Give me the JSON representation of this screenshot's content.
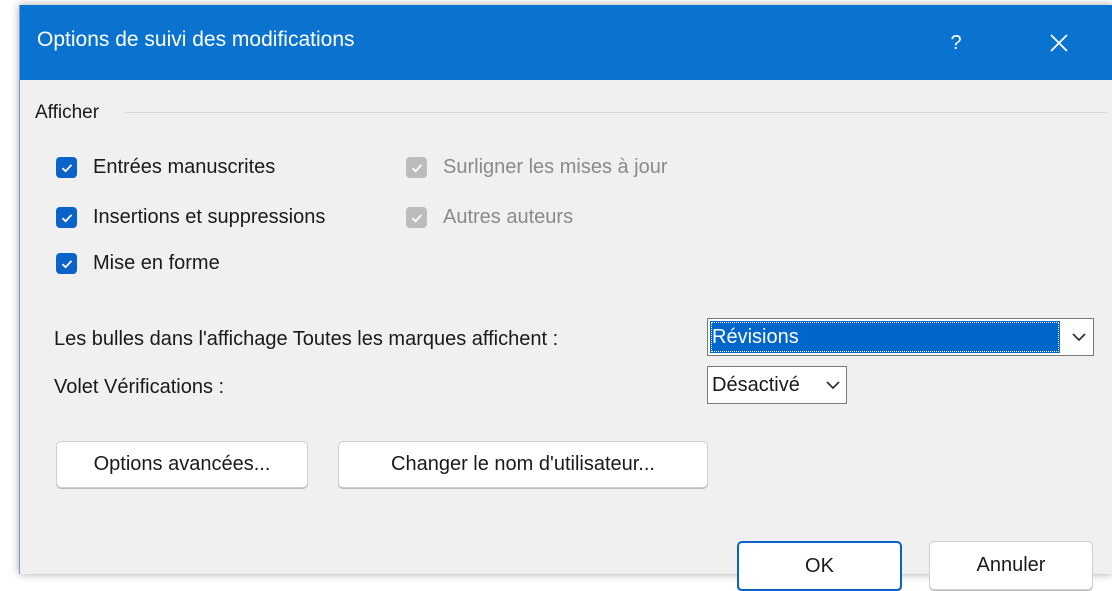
{
  "dialog": {
    "title": "Options de suivi des modifications",
    "help_label": "?"
  },
  "afficher": {
    "group_label": "Afficher",
    "checkboxes": [
      {
        "label": "Entrées manuscrites",
        "checked": true,
        "enabled": true
      },
      {
        "label": "Insertions et suppressions",
        "checked": true,
        "enabled": true
      },
      {
        "label": "Mise en forme",
        "checked": true,
        "enabled": true
      },
      {
        "label": "Surligner les mises à jour",
        "checked": true,
        "enabled": false
      },
      {
        "label": "Autres auteurs",
        "checked": true,
        "enabled": false
      }
    ]
  },
  "bulles": {
    "label": "Les bulles dans l'affichage Toutes les marques affichent :",
    "value": "Révisions"
  },
  "volet": {
    "label": "Volet Vérifications :",
    "value": "Désactivé"
  },
  "buttons": {
    "advanced": "Options avancées...",
    "change_user": "Changer le nom d'utilisateur...",
    "ok": "OK",
    "cancel": "Annuler"
  },
  "colors": {
    "title_bar": "#0a73cf",
    "checkbox": "#0a63c9",
    "selection": "#0066cc"
  }
}
